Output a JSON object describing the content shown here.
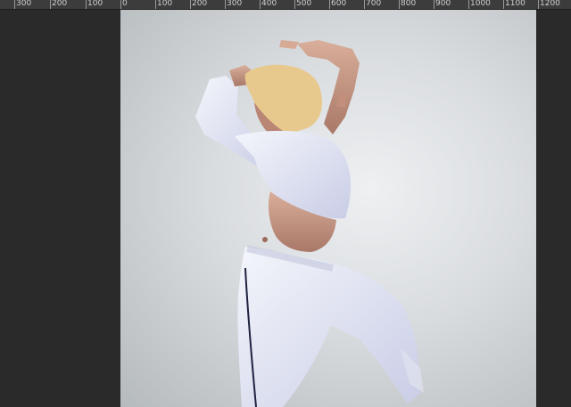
{
  "ruler": {
    "labels": [
      "300",
      "200",
      "100",
      "0",
      "100",
      "200",
      "300",
      "400",
      "500",
      "600",
      "700",
      "800",
      "900",
      "1000",
      "1100",
      "1200"
    ]
  },
  "canvas": {
    "subject": "dancer-photo"
  },
  "colors": {
    "ruler_bg": "#3c3c3c",
    "pasteboard": "#2a2a2a",
    "canvas_light": "#eef0f2",
    "canvas_dark": "#b5babd",
    "clothing": "#e6e9f5",
    "skin": "#c99a86",
    "hair": "#e7c98d"
  }
}
